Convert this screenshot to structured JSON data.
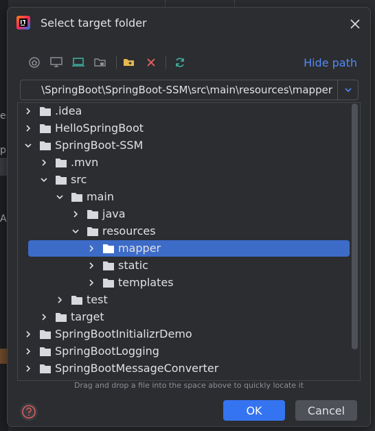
{
  "background": {
    "ide_fragments": [
      "er",
      "p",
      "A"
    ]
  },
  "dialog": {
    "title": "Select target folder",
    "app_icon": "intellij-idea-icon",
    "toolbar": {
      "buttons": [
        "home-icon",
        "desktop-icon",
        "project-icon",
        "module-icon",
        "new-folder-icon",
        "delete-icon",
        "refresh-icon"
      ],
      "hide_path_label": "Hide path"
    },
    "path": {
      "value": "\\SpringBoot\\SpringBoot-SSM\\src\\main\\resources\\mapper"
    },
    "tree": {
      "rows": [
        {
          "label": ".idea",
          "depth": 0,
          "expanded": false,
          "selected": false
        },
        {
          "label": "HelloSpringBoot",
          "depth": 0,
          "expanded": false,
          "selected": false
        },
        {
          "label": "SpringBoot-SSM",
          "depth": 0,
          "expanded": true,
          "selected": false
        },
        {
          "label": ".mvn",
          "depth": 1,
          "expanded": false,
          "selected": false
        },
        {
          "label": "src",
          "depth": 1,
          "expanded": true,
          "selected": false
        },
        {
          "label": "main",
          "depth": 2,
          "expanded": true,
          "selected": false
        },
        {
          "label": "java",
          "depth": 3,
          "expanded": false,
          "selected": false
        },
        {
          "label": "resources",
          "depth": 3,
          "expanded": true,
          "selected": false
        },
        {
          "label": "mapper",
          "depth": 4,
          "expanded": false,
          "selected": true
        },
        {
          "label": "static",
          "depth": 4,
          "expanded": false,
          "selected": false
        },
        {
          "label": "templates",
          "depth": 4,
          "expanded": false,
          "selected": false
        },
        {
          "label": "test",
          "depth": 2,
          "expanded": false,
          "selected": false
        },
        {
          "label": "target",
          "depth": 1,
          "expanded": false,
          "selected": false
        },
        {
          "label": "SpringBootInitializrDemo",
          "depth": 0,
          "expanded": false,
          "selected": false
        },
        {
          "label": "SpringBootLogging",
          "depth": 0,
          "expanded": false,
          "selected": false
        },
        {
          "label": "SpringBootMessageConverter",
          "depth": 0,
          "expanded": false,
          "selected": false
        }
      ]
    },
    "hint": "Drag and drop a file into the space above to quickly locate it",
    "buttons": {
      "ok": "OK",
      "cancel": "Cancel",
      "help_icon": "help-icon"
    },
    "colors": {
      "accent": "#3574f0",
      "selection": "#3d6bc8",
      "link": "#548af7",
      "delete": "#db5c5c",
      "refresh": "#3fb5a6",
      "folder_new": "#e6b84f"
    }
  }
}
